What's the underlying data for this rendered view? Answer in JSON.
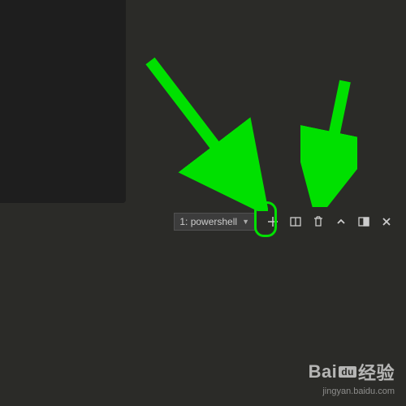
{
  "terminal": {
    "selector_label": "1: powershell",
    "icons": {
      "plus": "plus-icon",
      "split": "split-panel-icon",
      "trash": "trash-icon",
      "chevron_up": "chevron-up-icon",
      "maximize": "maximize-panel-icon",
      "close": "close-icon"
    }
  },
  "annotation": {
    "highlight_color": "#00e000"
  },
  "watermark": {
    "brand_left": "Bai",
    "brand_box": "du",
    "brand_right": "经验",
    "url": "jingyan.baidu.com"
  }
}
